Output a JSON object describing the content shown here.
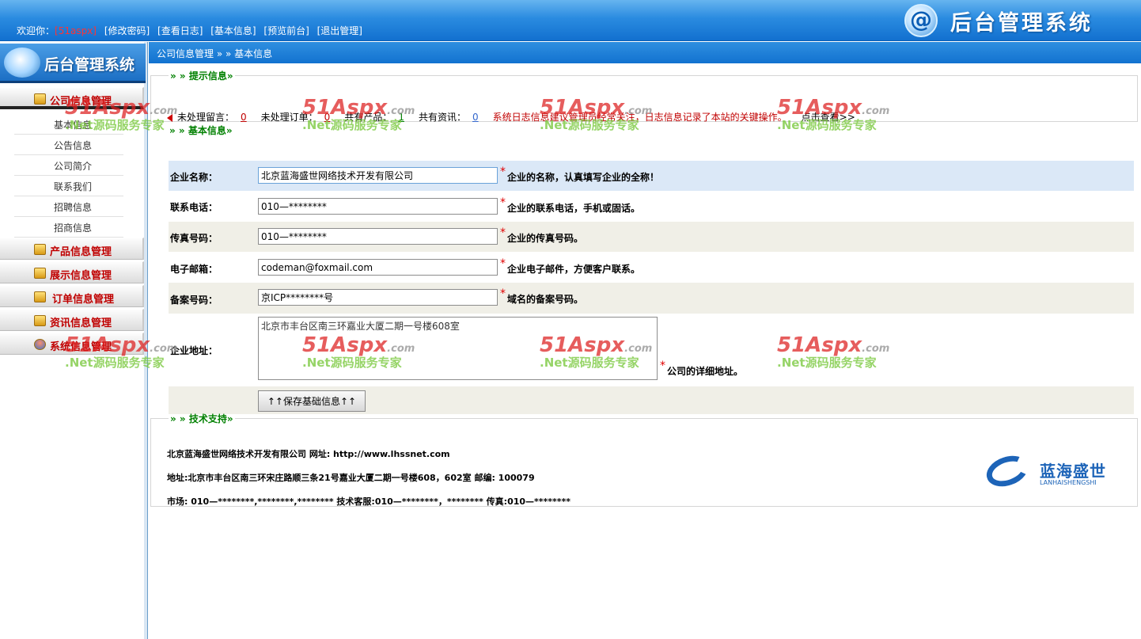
{
  "header": {
    "welcome": "欢迎你：",
    "username": "[51aspx]",
    "links": [
      "[修改密码]",
      "[查看日志]",
      "[基本信息]",
      "[预览前台]",
      "[退出管理]"
    ],
    "brand_icon": "@",
    "brand_title": "后台管理系统"
  },
  "sidebar": {
    "logo_title": "后台管理系统",
    "menus": [
      {
        "label": "公司信息管理",
        "icon": "computer-icon",
        "active": true
      },
      {
        "label": "产品信息管理",
        "icon": "notepad-icon"
      },
      {
        "label": "展示信息管理",
        "icon": "box-icon"
      },
      {
        "label": "订单信息管理",
        "icon": "edit-icon"
      },
      {
        "label": "资讯信息管理",
        "icon": "shield-icon"
      },
      {
        "label": "系统信息管理",
        "icon": "user-icon"
      }
    ],
    "sub_items": [
      "基本信息",
      "公告信息",
      "公司简介",
      "联系我们",
      "招聘信息",
      "招商信息"
    ]
  },
  "breadcrumb": "公司信息管理 » » 基本信息",
  "tips": {
    "legend": "» » 提示信息»",
    "unread_label": "未处理留言：",
    "unread_value": "0",
    "orders_label": "未处理订单：",
    "orders_value": "0",
    "products_label": "共有产品：",
    "products_value": "1",
    "news_label": "共有资讯：",
    "news_value": "0",
    "warning": "系统日志信息建议管理员经常关注，日志信息记录了本站的关键操作。",
    "view_link": "点击查看>>"
  },
  "form": {
    "legend": "» » 基本信息»",
    "fields": [
      {
        "label": "企业名称：",
        "value": "北京蓝海盛世网络技术开发有限公司",
        "hint": "企业的名称，认真填写企业的全称！"
      },
      {
        "label": "联系电话：",
        "value": "010—********",
        "hint": "企业的联系电话，手机或固话。"
      },
      {
        "label": "传真号码：",
        "value": "010—********",
        "hint": "企业的传真号码。"
      },
      {
        "label": "电子邮箱：",
        "value": "codeman@foxmail.com",
        "hint": "企业电子邮件，方便客户联系。"
      },
      {
        "label": "备案号码：",
        "value": "京ICP********号",
        "hint": "域名的备案号码。"
      }
    ],
    "address": {
      "label": "企业地址：",
      "value": "北京市丰台区南三环嘉业大厦二期一号楼608室",
      "hint": "公司的详细地址。"
    },
    "required_mark": "*",
    "save_button": "↑↑保存基础信息↑↑"
  },
  "support": {
    "legend": "» » 技术支持»",
    "line1": "北京蓝海盛世网络技术开发有限公司 网址:   http://www.lhssnet.com",
    "line2": "地址:北京市丰台区南三环宋庄路顺三条21号嘉业大厦二期一号楼608，602室  邮编:   100079",
    "line3": "市场: 010—********,********,******** 技术客服:010—********，******** 传真:010—********",
    "logo_cn": "蓝海盛世",
    "logo_en": "LANHAISHENGSHI"
  },
  "watermark": {
    "brand": "51Aspx",
    "domain": ".com",
    "slogan": ".Net源码服务专家"
  },
  "colors": {
    "header_blue": "#1270cf",
    "menu_red": "#c00000",
    "legend_green": "#008000",
    "required_red": "#e00000"
  }
}
